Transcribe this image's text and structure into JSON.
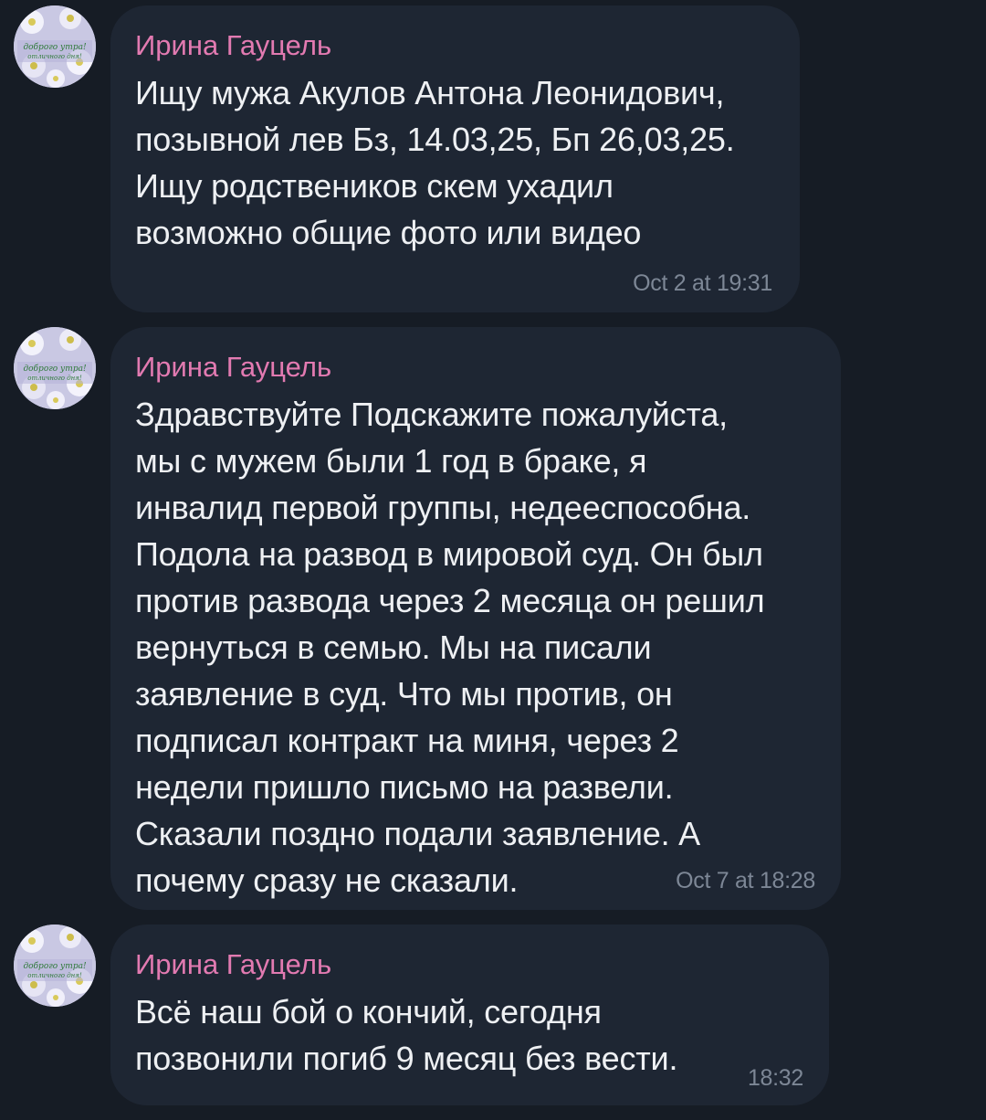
{
  "avatar": {
    "caption_line1": "доброго утра!",
    "caption_line2": "отличного дня!"
  },
  "messages": [
    {
      "sender": "Ирина Гауцель",
      "lines": [
        "Ищу мужа Акулов Антона Леонидович,",
        "позывной лев Бз, 14.03,25, Бп 26,03,25.",
        "Ищу родствеников скем  ухадил",
        "возможно общие фото или видео"
      ],
      "time": "Oct 2 at 19:31"
    },
    {
      "sender": "Ирина Гауцель",
      "lines": [
        "Здравствуйте Подскажите пожалуйста,",
        "мы с мужем были 1 год в браке, я",
        "инвалид первой группы, недееспособна.",
        "Подола на развод в мировой суд. Он был",
        "против развода через 2 месяца он решил",
        "вернуться в семью. Мы на писали",
        "заявление в суд. Что мы против, он",
        "подписал контракт на миня, через 2",
        "недели пришло письмо на развели.",
        "Сказали поздно подали заявление. А",
        "почему сразу не сказали."
      ],
      "time": "Oct 7 at 18:28"
    },
    {
      "sender": "Ирина Гауцель",
      "lines": [
        "Всё наш бой о кончий, сегодня",
        "позвонили погиб 9 месяц без вести."
      ],
      "time": "18:32"
    }
  ],
  "colors": {
    "background": "#161c25",
    "bubble": "#1e2633",
    "sender": "#e27ab1",
    "text": "#eef0f3",
    "time": "#7d8796"
  }
}
